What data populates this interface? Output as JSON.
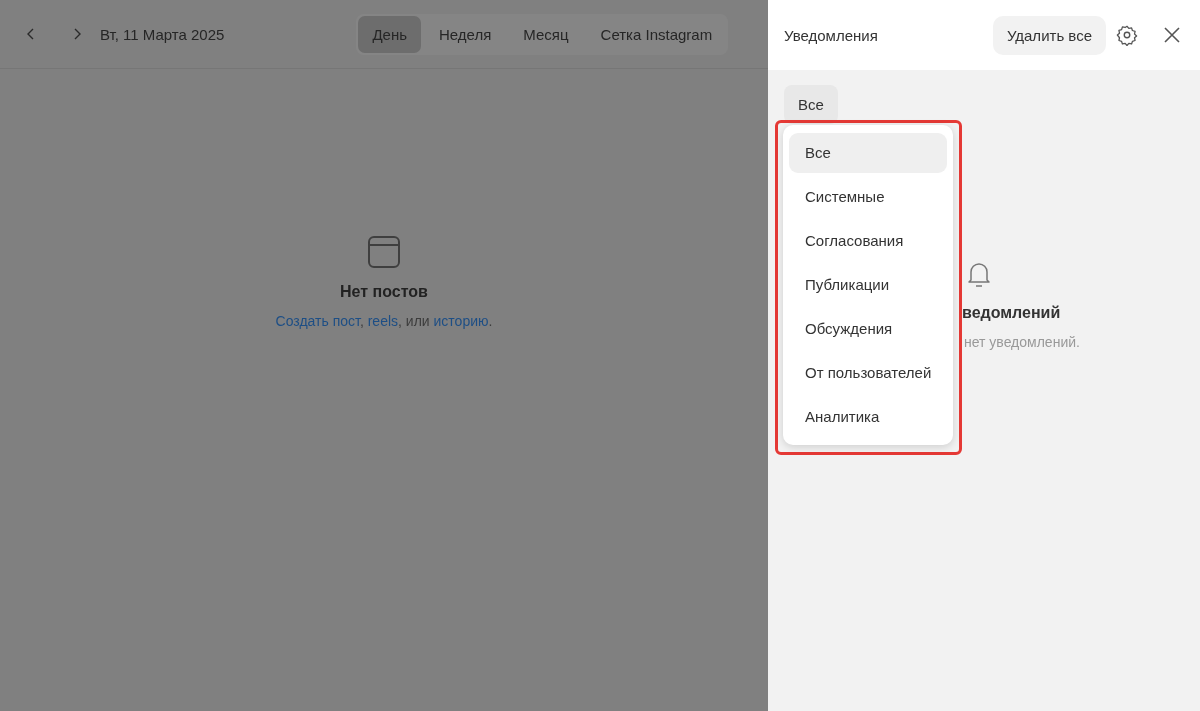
{
  "calendar": {
    "date": "Вт, 11 Марта 2025",
    "views": [
      {
        "label": "День",
        "selected": true
      },
      {
        "label": "Неделя",
        "selected": false
      },
      {
        "label": "Месяц",
        "selected": false
      },
      {
        "label": "Сетка Instagram",
        "selected": false
      }
    ],
    "empty": {
      "title": "Нет постов",
      "parts": [
        {
          "text": "Создать пост",
          "kind": "link"
        },
        {
          "text": ", ",
          "kind": "text"
        },
        {
          "text": "reels",
          "kind": "link"
        },
        {
          "text": ", или ",
          "kind": "text"
        },
        {
          "text": "историю",
          "kind": "link"
        },
        {
          "text": ".",
          "kind": "text"
        }
      ]
    }
  },
  "notifications": {
    "title": "Уведомления",
    "delete_all": "Удалить все",
    "filter": "Все",
    "filter_options": [
      {
        "label": "Все",
        "selected": true
      },
      {
        "label": "Системные",
        "selected": false
      },
      {
        "label": "Согласования",
        "selected": false
      },
      {
        "label": "Публикации",
        "selected": false
      },
      {
        "label": "Обсуждения",
        "selected": false
      },
      {
        "label": "От пользователей",
        "selected": false
      },
      {
        "label": "Аналитика",
        "selected": false
      }
    ],
    "empty": {
      "title": "ведомлений",
      "text": "нет уведомлений."
    }
  }
}
